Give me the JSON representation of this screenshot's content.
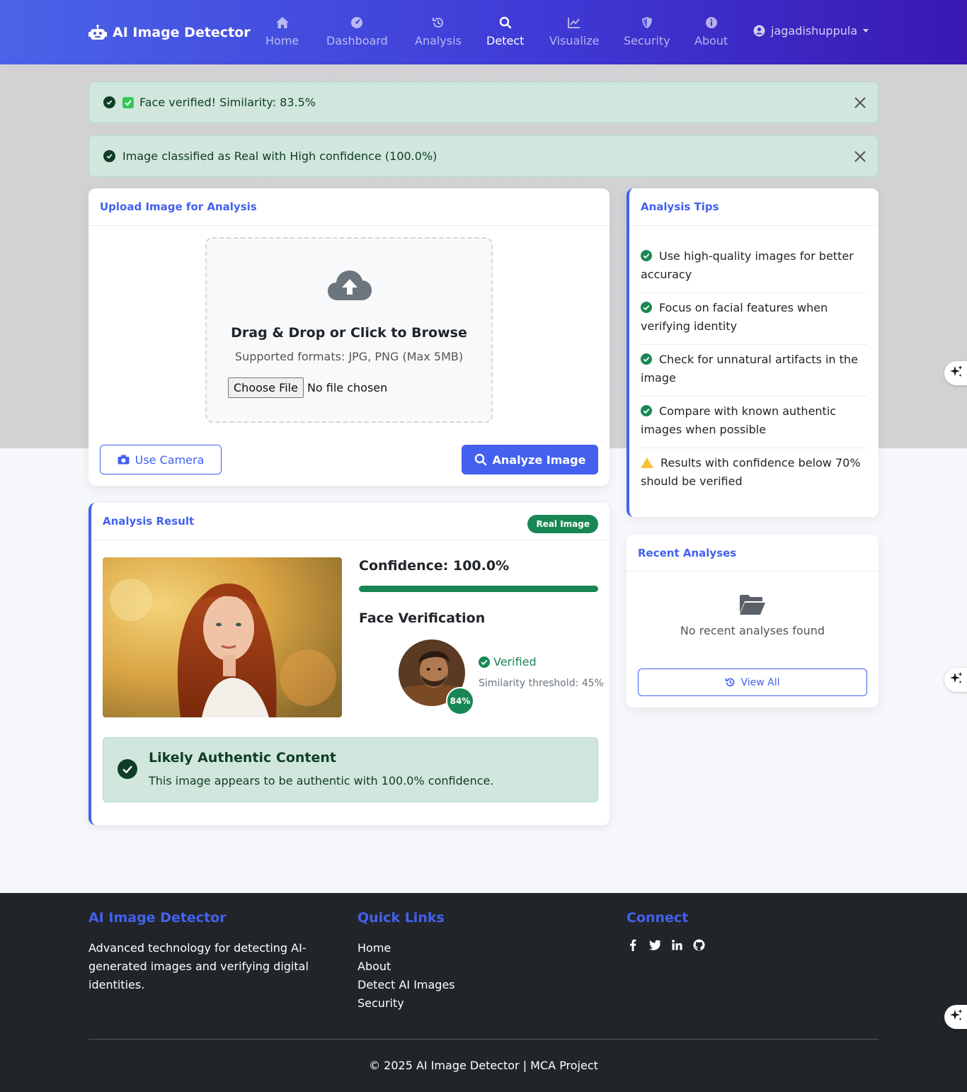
{
  "brand": {
    "name": "AI Image Detector",
    "icon": "robot-icon"
  },
  "nav": [
    {
      "label": "Home",
      "icon": "home-icon"
    },
    {
      "label": "Dashboard",
      "icon": "gauge-icon"
    },
    {
      "label": "Analysis",
      "icon": "history-icon"
    },
    {
      "label": "Detect",
      "icon": "search-icon",
      "active": true
    },
    {
      "label": "Visualize",
      "icon": "chart-line-icon"
    },
    {
      "label": "Security",
      "icon": "shield-icon"
    },
    {
      "label": "About",
      "icon": "info-icon"
    }
  ],
  "user": {
    "name": "jagadishuppula"
  },
  "alerts": [
    {
      "text": "Face verified! Similarity: 83.5%"
    },
    {
      "text": "Image classified as Real with High confidence (100.0%)"
    }
  ],
  "upload": {
    "header": "Upload Image for Analysis",
    "title": "Drag & Drop or Click to Browse",
    "subtitle": "Supported formats: JPG, PNG (Max 5MB)",
    "choose_label": "Choose File",
    "no_file": "No file chosen",
    "camera_label": "Use Camera",
    "analyze_label": "Analyze Image"
  },
  "tips": {
    "header": "Analysis Tips",
    "items": [
      {
        "text": "Use high-quality images for better accuracy",
        "type": "check"
      },
      {
        "text": "Focus on facial features when verifying identity",
        "type": "check"
      },
      {
        "text": "Check for unnatural artifacts in the image",
        "type": "check"
      },
      {
        "text": "Compare with known authentic images when possible",
        "type": "check"
      },
      {
        "text": "Results with confidence below 70% should be verified",
        "type": "warning"
      }
    ]
  },
  "result": {
    "header": "Analysis Result",
    "badge": "Real Image",
    "confidence_text": "Confidence: 100.0%",
    "confidence": 1.0,
    "face_title": "Face Verification",
    "match_pct": "84%",
    "verified_label": "Verified",
    "threshold_text": "Similarity threshold: 45%",
    "auth_title": "Likely Authentic Content",
    "auth_text": "This image appears to be authentic with 100.0% confidence.",
    "colors": {
      "success": "#198754",
      "accent": "#4361ee"
    }
  },
  "recent": {
    "header": "Recent Analyses",
    "empty_text": "No recent analyses found",
    "view_all": "View All"
  },
  "footer": {
    "brand_title": "AI Image Detector",
    "brand_text": "Advanced technology for detecting AI-generated images and verifying digital identities.",
    "links_title": "Quick Links",
    "links": [
      "Home",
      "About",
      "Detect AI Images",
      "Security"
    ],
    "connect_title": "Connect",
    "social": [
      "facebook-icon",
      "twitter-icon",
      "linkedin-icon",
      "github-icon"
    ],
    "copyright": "© 2025 AI Image Detector | MCA Project"
  }
}
